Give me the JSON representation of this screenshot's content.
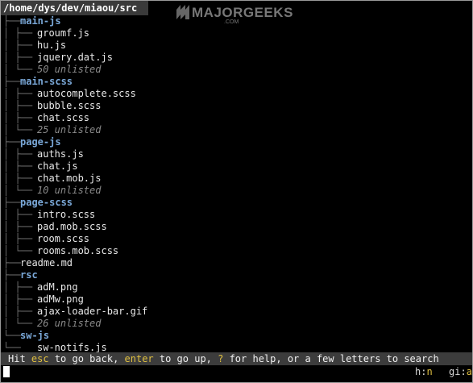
{
  "root_path": "/home/dys/dev/miaou/src",
  "watermark": {
    "text": "MAJORGEEKS",
    "sub": ".COM"
  },
  "tree": [
    {
      "kind": "dir",
      "name": "main-js"
    },
    {
      "kind": "file",
      "name": "groumf.js"
    },
    {
      "kind": "file",
      "name": "hu.js"
    },
    {
      "kind": "file",
      "name": "jquery.dat.js"
    },
    {
      "kind": "unlisted",
      "name": "50 unlisted"
    },
    {
      "kind": "dir",
      "name": "main-scss"
    },
    {
      "kind": "file",
      "name": "autocomplete.scss"
    },
    {
      "kind": "file",
      "name": "bubble.scss"
    },
    {
      "kind": "file",
      "name": "chat.scss"
    },
    {
      "kind": "unlisted",
      "name": "25 unlisted"
    },
    {
      "kind": "dir",
      "name": "page-js"
    },
    {
      "kind": "file",
      "name": "auths.js"
    },
    {
      "kind": "file",
      "name": "chat.js"
    },
    {
      "kind": "file",
      "name": "chat.mob.js"
    },
    {
      "kind": "unlisted",
      "name": "10 unlisted"
    },
    {
      "kind": "dir",
      "name": "page-scss"
    },
    {
      "kind": "file",
      "name": "intro.scss"
    },
    {
      "kind": "file",
      "name": "pad.mob.scss"
    },
    {
      "kind": "file",
      "name": "room.scss"
    },
    {
      "kind": "file",
      "name": "rooms.mob.scss"
    },
    {
      "kind": "rootfile",
      "name": "readme.md"
    },
    {
      "kind": "dir",
      "name": "rsc"
    },
    {
      "kind": "file",
      "name": "adM.png"
    },
    {
      "kind": "file",
      "name": "adMw.png"
    },
    {
      "kind": "file",
      "name": "ajax-loader-bar.gif"
    },
    {
      "kind": "unlisted",
      "name": "26 unlisted"
    },
    {
      "kind": "dir",
      "name": "sw-js"
    },
    {
      "kind": "file",
      "name": "sw-notifs.js"
    }
  ],
  "status": {
    "t1": "Hit ",
    "k1": "esc",
    "t2": " to go back, ",
    "k2": "enter",
    "t3": " to go up, ",
    "k3": "?",
    "t4": " for help, or a few letters to search"
  },
  "input": {
    "hint1_key": "h",
    "hint1_val": "n",
    "hint2_key": "gi",
    "hint2_val": "a"
  }
}
